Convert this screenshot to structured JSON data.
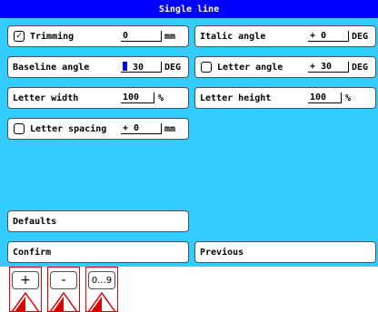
{
  "window": {
    "title": "Single line"
  },
  "left": {
    "trimming": {
      "label": "Trimming",
      "checked": true,
      "check_glyph": "✓",
      "value": "0",
      "unit": "mm"
    },
    "baseline_angle": {
      "label": "Baseline angle",
      "value": "30",
      "unit": "DEG"
    },
    "letter_width": {
      "label": "Letter width",
      "value": "100",
      "unit": "%"
    },
    "letter_spacing": {
      "label": "Letter spacing",
      "checked": false,
      "value": "+ 0",
      "unit": "mm"
    }
  },
  "right": {
    "italic_angle": {
      "label": "Italic angle",
      "value": "+ 0",
      "unit": "DEG"
    },
    "letter_angle": {
      "label": "Letter angle",
      "checked": false,
      "value": "+ 30",
      "unit": "DEG"
    },
    "letter_height": {
      "label": "Letter height",
      "value": "100",
      "unit": "%"
    }
  },
  "buttons": {
    "defaults": "Defaults",
    "confirm": "Confirm",
    "previous": "Previous"
  },
  "keys": {
    "plus": "+",
    "minus": "-",
    "digits": "0...9"
  },
  "colors": {
    "title_bg": "#0000ff",
    "panel_bg": "#33ccff",
    "key_frame": "#e00000",
    "arrow": "#e00000"
  }
}
